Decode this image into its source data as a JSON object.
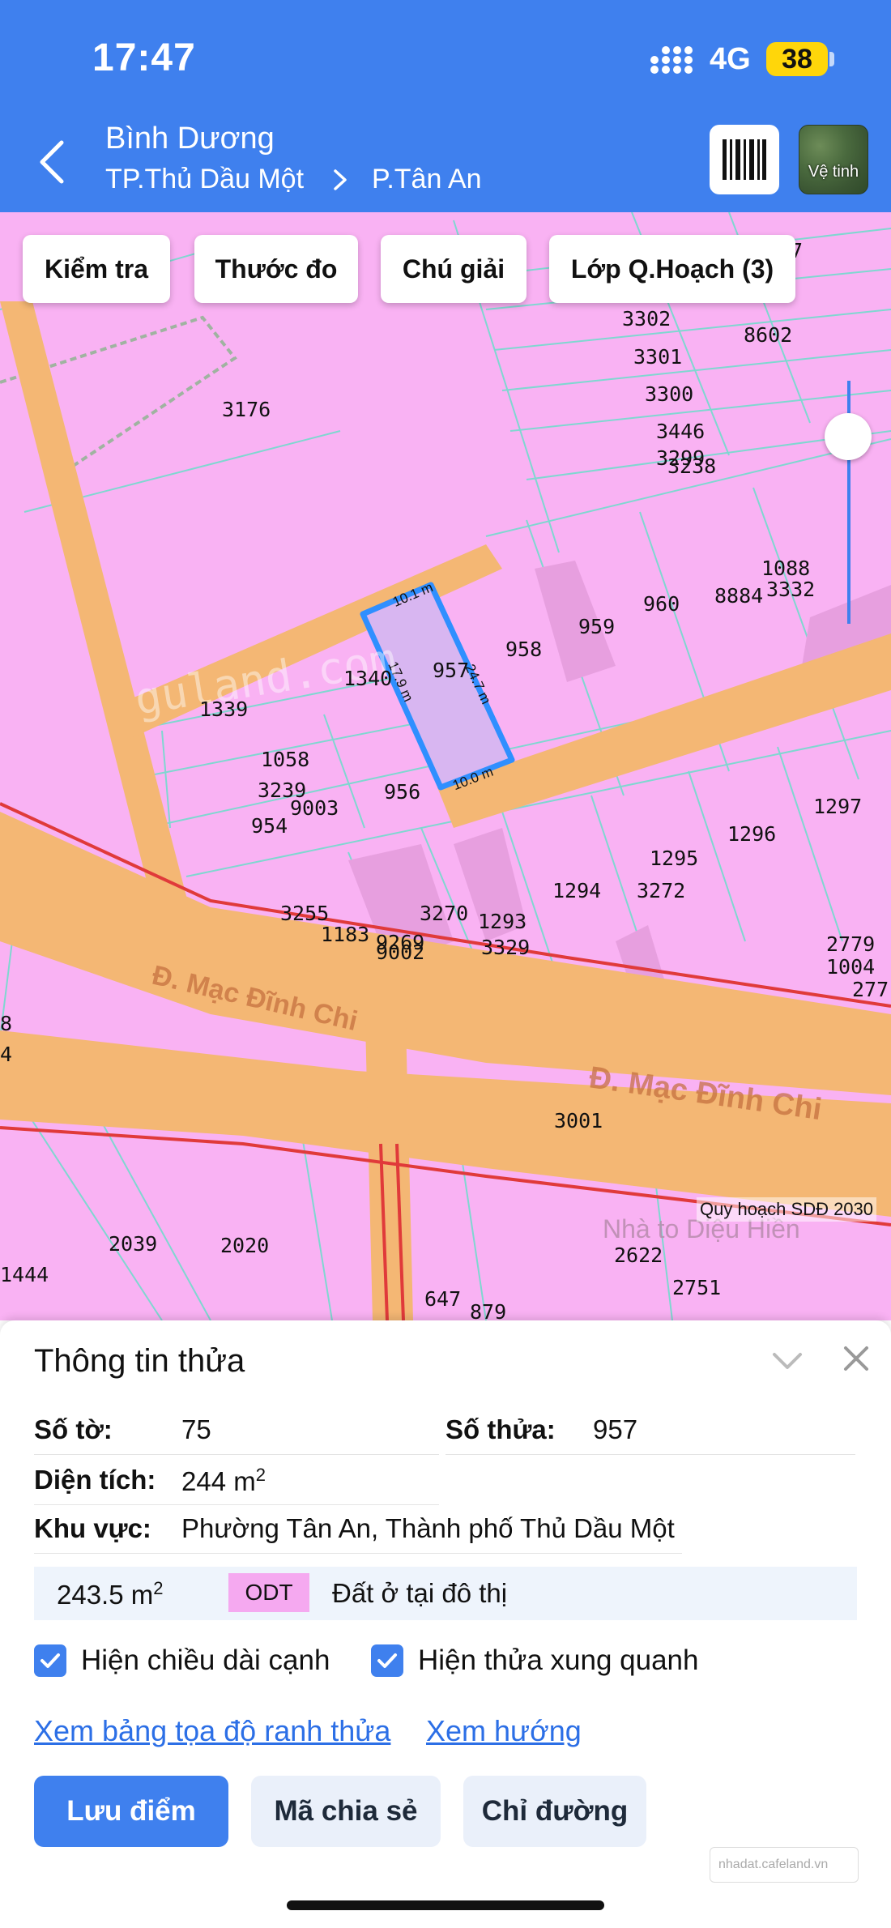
{
  "status": {
    "time": "17:47",
    "network": "4G",
    "battery": "38"
  },
  "header": {
    "region": "Bình Dương",
    "city": "TP.Thủ Dầu Một",
    "ward": "P.Tân An",
    "satellite_label": "Vệ tinh"
  },
  "toolbar": {
    "check_label": "Kiểm tra",
    "ruler_label": "Thước đo",
    "legend_label": "Chú giải",
    "layers_label": "Lớp Q.Hoạch (3)"
  },
  "map": {
    "plan_label": "Quy hoạch SDĐ 2030",
    "road_name_1": "Đ. Mạc Đĩnh Chi",
    "road_name_2": "Đ. Mạc Đĩnh Chi",
    "watermark_text": "guland.com",
    "poi_label": "Nhà to Diệu Hiền",
    "edge_labels": {
      "top": "10.1 m",
      "right": "24.7 m",
      "bottom": "10.0 m",
      "left": "17.9 m"
    },
    "parcel_numbers": [
      {
        "id": "p3302",
        "text": "3302"
      },
      {
        "id": "p8602",
        "text": "8602"
      },
      {
        "id": "p3301",
        "text": "3301"
      },
      {
        "id": "p3300",
        "text": "3300"
      },
      {
        "id": "p3446",
        "text": "3446"
      },
      {
        "id": "p3299",
        "text": "3299"
      },
      {
        "id": "p3238",
        "text": "3238"
      },
      {
        "id": "p3176",
        "text": "3176"
      },
      {
        "id": "p1088",
        "text": "1088"
      },
      {
        "id": "p8884",
        "text": "8884"
      },
      {
        "id": "p3332",
        "text": "3332"
      },
      {
        "id": "p960",
        "text": "960"
      },
      {
        "id": "p959",
        "text": "959"
      },
      {
        "id": "p958",
        "text": "958"
      },
      {
        "id": "p957",
        "text": "957"
      },
      {
        "id": "p1340",
        "text": "1340"
      },
      {
        "id": "p1339",
        "text": "1339"
      },
      {
        "id": "p1058",
        "text": "1058"
      },
      {
        "id": "p3239",
        "text": "3239"
      },
      {
        "id": "p9003",
        "text": "9003"
      },
      {
        "id": "p954",
        "text": "954"
      },
      {
        "id": "p956",
        "text": "956"
      },
      {
        "id": "p1297",
        "text": "1297"
      },
      {
        "id": "p1296",
        "text": "1296"
      },
      {
        "id": "p1295",
        "text": "1295"
      },
      {
        "id": "p3272",
        "text": "3272"
      },
      {
        "id": "p1294",
        "text": "1294"
      },
      {
        "id": "p3255",
        "text": "3255"
      },
      {
        "id": "p3270",
        "text": "3270"
      },
      {
        "id": "p1293",
        "text": "1293"
      },
      {
        "id": "p1183",
        "text": "1183"
      },
      {
        "id": "p9269",
        "text": "9269"
      },
      {
        "id": "p9002",
        "text": "9002"
      },
      {
        "id": "p3329",
        "text": "3329"
      },
      {
        "id": "p2779",
        "text": "2779"
      },
      {
        "id": "p1004",
        "text": "1004"
      },
      {
        "id": "p277",
        "text": "277"
      },
      {
        "id": "p3001",
        "text": "3001"
      },
      {
        "id": "p2039",
        "text": "2039"
      },
      {
        "id": "p2020",
        "text": "2020"
      },
      {
        "id": "p2622",
        "text": "2622"
      },
      {
        "id": "p2751",
        "text": "2751"
      },
      {
        "id": "p647",
        "text": "647"
      },
      {
        "id": "p879",
        "text": "879"
      },
      {
        "id": "p1444",
        "text": "1444"
      },
      {
        "id": "p1297b",
        "text": "1297"
      },
      {
        "id": "p8",
        "text": "8"
      },
      {
        "id": "p4",
        "text": "4"
      },
      {
        "id": "p7",
        "text": "7"
      }
    ]
  },
  "panel": {
    "title": "Thông tin thửa",
    "sheet_label": "Số tờ:",
    "sheet_value": "75",
    "parcel_label": "Số thửa:",
    "parcel_value": "957",
    "area_label": "Diện tích:",
    "area_value": "244 m",
    "area_unit_sup": "2",
    "zone_label": "Khu vực:",
    "zone_value": "Phường Tân An, Thành phố Thủ Dầu Một",
    "land_area": "243.5 m",
    "land_area_sup": "2",
    "land_code": "ODT",
    "land_desc": "Đất ở tại đô thị",
    "show_edges_label": "Hiện chiều dài cạnh",
    "show_neighbors_label": "Hiện thửa xung quanh",
    "coords_link": "Xem bảng tọa độ ranh thửa",
    "direction_link": "Xem hướng",
    "save_label": "Lưu điểm",
    "share_label": "Mã chia sẻ",
    "route_label": "Chỉ đường",
    "watermark": "nhadat.cafeland.vn"
  },
  "colors": {
    "accent": "#3f80ee",
    "residential": "#f9b2f3",
    "road": "#f4b774"
  },
  "icons": [
    "back-chevron-icon",
    "chevron-right-icon",
    "barcode-icon",
    "satellite-icon",
    "chevron-down-icon",
    "close-icon",
    "checkmark-icon"
  ]
}
